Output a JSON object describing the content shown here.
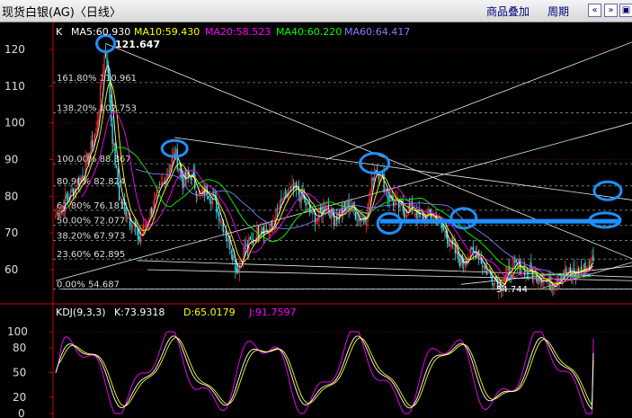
{
  "window": {
    "title": "现货白银(AG)〈日线〉",
    "buttons": {
      "overlay": "商品叠加",
      "period": "周期"
    },
    "nav_icons": [
      "double-left-arrow-icon",
      "double-right-arrow-icon"
    ]
  },
  "main_header": {
    "k_label": "K",
    "ma": [
      {
        "label": "MA5:60.930",
        "color": "#ffffff"
      },
      {
        "label": "MA10:59.430",
        "color": "#ffff00"
      },
      {
        "label": "MA20:58.523",
        "color": "#ff00ff"
      },
      {
        "label": "MA40:60.220",
        "color": "#00ff00"
      },
      {
        "label": "MA60:64.417",
        "color": "#8080ff"
      }
    ]
  },
  "fib": [
    {
      "label": "161.80% 110.961",
      "value": 110.961
    },
    {
      "label": "138.20% 102.753",
      "value": 102.753
    },
    {
      "label": "100.00% 88.867",
      "value": 88.867
    },
    {
      "label": "80.90% 82.824",
      "value": 82.824
    },
    {
      "label": "61.80% 76.181",
      "value": 76.181
    },
    {
      "label": "50.00% 72.077",
      "value": 72.077
    },
    {
      "label": "38.20% 67.973",
      "value": 67.973
    },
    {
      "label": "23.60% 62.895",
      "value": 62.895
    },
    {
      "label": "0.00% 54.687",
      "value": 54.687
    }
  ],
  "annotations": {
    "high": "121.647",
    "low": "54.744"
  },
  "kdj_header": {
    "title": "KDJ(9,3,3)",
    "k": {
      "label": "K:73.9318",
      "color": "#ffffff"
    },
    "d": {
      "label": "D:65.0179",
      "color": "#ffff00"
    },
    "j": {
      "label": "J:91.7597",
      "color": "#ff00ff"
    }
  },
  "colors": {
    "up": "#ff3030",
    "down": "#30ffff",
    "axis": "#d00000",
    "fib": "#888888",
    "highlight": "#1e90ff"
  },
  "chart_data": [
    {
      "type": "candlestick",
      "title": "现货白银(AG)〈日线〉",
      "yticks": [
        60,
        70,
        80,
        90,
        100,
        110,
        120
      ],
      "ylim": [
        52,
        124
      ],
      "grid": "horizontal dotted",
      "series": [
        {
          "name": "MA5",
          "current": 60.93
        },
        {
          "name": "MA10",
          "current": 59.43
        },
        {
          "name": "MA20",
          "current": 58.523
        },
        {
          "name": "MA40",
          "current": 60.22
        },
        {
          "name": "MA60",
          "current": 64.417
        }
      ],
      "close_anchors": [
        [
          0,
          75
        ],
        [
          10,
          80
        ],
        [
          20,
          86
        ],
        [
          30,
          98
        ],
        [
          37,
          121.6
        ],
        [
          42,
          96
        ],
        [
          47,
          80
        ],
        [
          52,
          76
        ],
        [
          58,
          72
        ],
        [
          62,
          68
        ],
        [
          68,
          74
        ],
        [
          75,
          80
        ],
        [
          82,
          86
        ],
        [
          88,
          92
        ],
        [
          94,
          84
        ],
        [
          100,
          86
        ],
        [
          106,
          80
        ],
        [
          112,
          82
        ],
        [
          118,
          78
        ],
        [
          124,
          72
        ],
        [
          130,
          66
        ],
        [
          134,
          60
        ],
        [
          140,
          66
        ],
        [
          146,
          68
        ],
        [
          152,
          72
        ],
        [
          158,
          70
        ],
        [
          164,
          76
        ],
        [
          170,
          80
        ],
        [
          176,
          82
        ],
        [
          182,
          80
        ],
        [
          188,
          76
        ],
        [
          194,
          74
        ],
        [
          200,
          78
        ],
        [
          206,
          74
        ],
        [
          212,
          76
        ],
        [
          218,
          78
        ],
        [
          224,
          74
        ],
        [
          230,
          75
        ],
        [
          236,
          88
        ],
        [
          240,
          86
        ],
        [
          246,
          80
        ],
        [
          252,
          78
        ],
        [
          258,
          76
        ],
        [
          264,
          77
        ],
        [
          270,
          74
        ],
        [
          276,
          75
        ],
        [
          282,
          74
        ],
        [
          288,
          70
        ],
        [
          294,
          66
        ],
        [
          300,
          62
        ],
        [
          306,
          64
        ],
        [
          312,
          65
        ],
        [
          318,
          60
        ],
        [
          324,
          58
        ],
        [
          330,
          56
        ],
        [
          336,
          60
        ],
        [
          342,
          61
        ],
        [
          348,
          60
        ],
        [
          354,
          59
        ],
        [
          360,
          58
        ],
        [
          366,
          56
        ],
        [
          372,
          58
        ],
        [
          378,
          59
        ],
        [
          384,
          59
        ],
        [
          390,
          60
        ],
        [
          395,
          61
        ],
        [
          398,
          63.5
        ]
      ],
      "count": 399
    },
    {
      "type": "line",
      "title": "KDJ(9,3,3)",
      "yticks": [
        0,
        20,
        50,
        80,
        100
      ],
      "ylim": [
        0,
        110
      ],
      "series": [
        {
          "name": "K",
          "current": 73.9318
        },
        {
          "name": "D",
          "current": 65.0179
        },
        {
          "name": "J",
          "current": 91.7597
        }
      ]
    }
  ]
}
